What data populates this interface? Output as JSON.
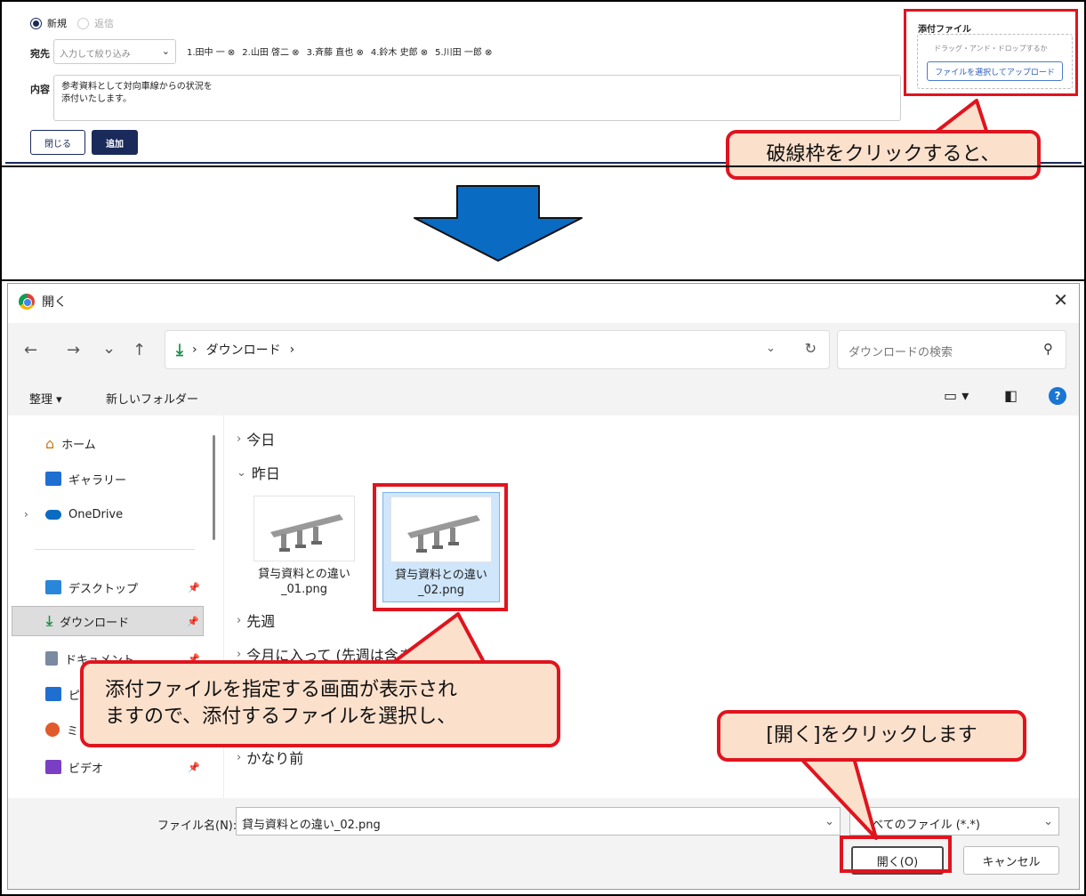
{
  "form": {
    "radio_new": "新規",
    "radio_reply": "返信",
    "to_label": "宛先",
    "to_placeholder": "入力して絞り込み",
    "recipients": [
      "1.田中 一 ⊗",
      "2.山田 啓二 ⊗",
      "3.斉藤 直也 ⊗",
      "4.鈴木 史郎 ⊗",
      "5.川田 一郎 ⊗"
    ],
    "body_label": "内容",
    "body_line1": "参考資料として対向車線からの状況を",
    "body_line2": "添付いたします。",
    "close_label": "閉じる",
    "add_label": "追加",
    "attach_title": "添付ファイル",
    "drop_text": "ドラッグ・アンド・ドロップするか",
    "upload_label": "ファイルを選択してアップロード"
  },
  "callouts": {
    "c1": "破線枠をクリックすると、",
    "c2_line1": "添付ファイルを指定する画面が表示され",
    "c2_line2": "ますので、添付するファイルを選択し、",
    "c3": "[開く]をクリックします"
  },
  "dialog": {
    "title": "開く",
    "close": "✕",
    "nav": {
      "back": "←",
      "forward": "→",
      "recent": "⌄",
      "up": "↑"
    },
    "address": {
      "sep": "›",
      "folder": "ダウンロード",
      "sep2": "›"
    },
    "search_placeholder": "ダウンロードの検索",
    "toolbar": {
      "organize": "整理 ▾",
      "new_folder": "新しいフォルダー",
      "help": "?"
    },
    "sidebar": [
      {
        "label": "ホーム"
      },
      {
        "label": "ギャラリー"
      },
      {
        "label": "OneDrive"
      },
      {
        "label": "デスクトップ"
      },
      {
        "label": "ダウンロード"
      },
      {
        "label": "ドキュメント"
      },
      {
        "label": "ピクチャ"
      },
      {
        "label": "ミュージック"
      },
      {
        "label": "ビデオ"
      }
    ],
    "groups": {
      "today": "今日",
      "yesterday": "昨日",
      "last_week": "先週",
      "this_month": "今月に入って (先週は含まず)",
      "long_ago": "かなり前"
    },
    "files": [
      {
        "name_line1": "貸与資料との違い",
        "name_line2": "_01.png"
      },
      {
        "name_line1": "貸与資料との違い",
        "name_line2": "_02.png"
      }
    ],
    "filename_label": "ファイル名(N):",
    "filename_value": "貸与資料との違い_02.png",
    "filetype": "すべてのファイル (*.*)",
    "open_label": "開く(O)",
    "cancel_label": "キャンセル"
  },
  "colors": {
    "highlight": "#e0141e",
    "callout_bg": "#fbe0cc",
    "arrow": "#0a6bc2",
    "navy": "#1a2a5a"
  }
}
